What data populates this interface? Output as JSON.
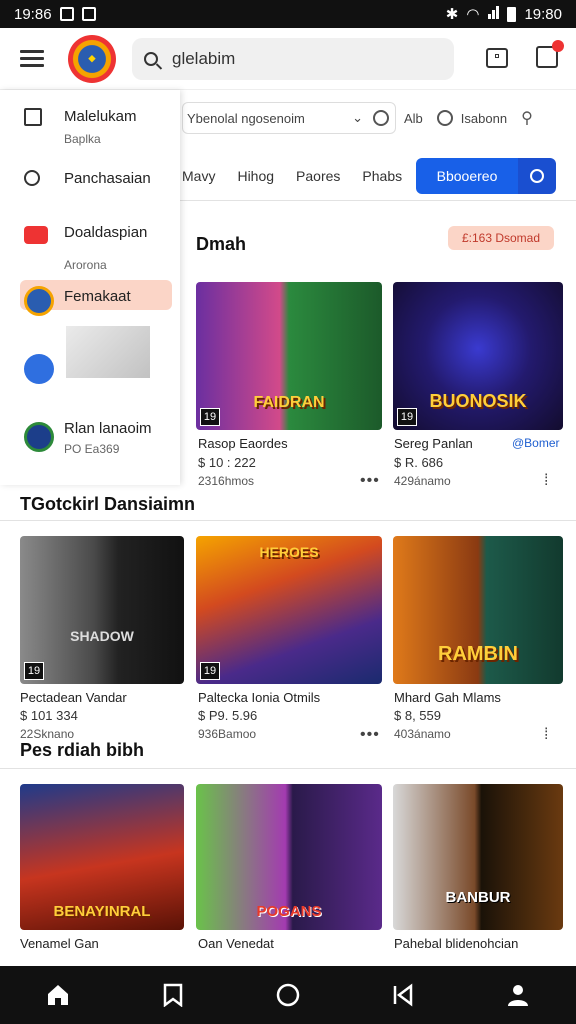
{
  "status_bar": {
    "time_left": "19:86",
    "time_right": "19:80"
  },
  "top_bar": {
    "search_value": "glelabim"
  },
  "drawer": {
    "items": [
      {
        "title": "Malelukam",
        "subtitle": "Baplka"
      },
      {
        "title": "Panchasaian",
        "subtitle": ""
      },
      {
        "title": "Doaldaspian",
        "subtitle": "Arorona"
      },
      {
        "title": "Femakaat",
        "subtitle": ""
      },
      {
        "title": "",
        "subtitle": ""
      },
      {
        "title": "Rlan lanaoim",
        "subtitle": "PO Ea369"
      }
    ]
  },
  "filter": {
    "select_value": "Ybenolal ngosenoim",
    "label_a": "Alb",
    "location": "Isabonn"
  },
  "tabs": [
    "Mavy",
    "Hihog",
    "Paores",
    "Phabs"
  ],
  "primary_button": "Bbooereo",
  "sections": [
    {
      "title": "Dmah",
      "badge": "£:163 Dsomad",
      "cards": [
        {
          "title": "Rasop Eaordes",
          "price": "$ 10 : 222",
          "meta": "2316hmos",
          "cover_text": "FAIDRAN",
          "rating": "19"
        },
        {
          "title": "Sereg Panlan",
          "price": "$ R. 686",
          "meta": "429ánamo",
          "tag": "@Bomer",
          "cover_text": "BUONOSIK",
          "rating": "19"
        }
      ]
    },
    {
      "title": "TGotckirl Dansiaimn",
      "cards": [
        {
          "title": "Pectadean Vandar",
          "price": "$ 101 334",
          "meta": "22Sknano",
          "cover_text": "SHADOW",
          "rating": "19"
        },
        {
          "title": "Paltecka Ionia Otmils",
          "price": "$ P9. 5.96",
          "meta": "936Bamoo",
          "cover_text": "HEROES",
          "rating": "19"
        },
        {
          "title": "Mhard Gah Mlams",
          "price": "$ 8, 559",
          "meta": "403ánamo",
          "cover_text": "RAMBIN",
          "rating": ""
        }
      ]
    },
    {
      "title": "Pes rdiah bibh",
      "cards": [
        {
          "title": "Venamel Gan",
          "cover_text": "BENAYINRAL"
        },
        {
          "title": "Oan Venedat",
          "cover_text": "POGANS"
        },
        {
          "title": "Pahebal blidenohcian",
          "cover_text": "BANBUR"
        }
      ]
    }
  ],
  "colors": {
    "accent": "#1860e8",
    "badge_bg": "#fbd5c7",
    "active_drawer": "#fbd5c7"
  }
}
